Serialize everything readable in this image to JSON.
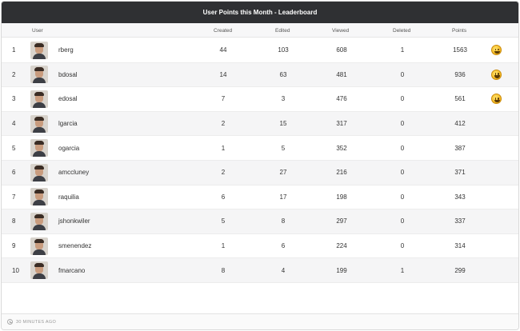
{
  "title": "User Points this Month - Leaderboard",
  "columns": {
    "user": "User",
    "created": "Created",
    "edited": "Edited",
    "viewed": "Viewed",
    "deleted": "Deleted",
    "points": "Points"
  },
  "rows": [
    {
      "rank": "1",
      "user": "rberg",
      "created": "44",
      "edited": "103",
      "viewed": "608",
      "deleted": "1",
      "points": "1563",
      "badge": true
    },
    {
      "rank": "2",
      "user": "bdosal",
      "created": "14",
      "edited": "63",
      "viewed": "481",
      "deleted": "0",
      "points": "936",
      "badge": true
    },
    {
      "rank": "3",
      "user": "edosal",
      "created": "7",
      "edited": "3",
      "viewed": "476",
      "deleted": "0",
      "points": "561",
      "badge": true
    },
    {
      "rank": "4",
      "user": "lgarcia",
      "created": "2",
      "edited": "15",
      "viewed": "317",
      "deleted": "0",
      "points": "412",
      "badge": false
    },
    {
      "rank": "5",
      "user": "ogarcia",
      "created": "1",
      "edited": "5",
      "viewed": "352",
      "deleted": "0",
      "points": "387",
      "badge": false
    },
    {
      "rank": "6",
      "user": "amccluney",
      "created": "2",
      "edited": "27",
      "viewed": "216",
      "deleted": "0",
      "points": "371",
      "badge": false
    },
    {
      "rank": "7",
      "user": "raquilia",
      "created": "6",
      "edited": "17",
      "viewed": "198",
      "deleted": "0",
      "points": "343",
      "badge": false
    },
    {
      "rank": "8",
      "user": "jshonkwiler",
      "created": "5",
      "edited": "8",
      "viewed": "297",
      "deleted": "0",
      "points": "337",
      "badge": false
    },
    {
      "rank": "9",
      "user": "smenendez",
      "created": "1",
      "edited": "6",
      "viewed": "224",
      "deleted": "0",
      "points": "314",
      "badge": false
    },
    {
      "rank": "10",
      "user": "fmarcano",
      "created": "8",
      "edited": "4",
      "viewed": "199",
      "deleted": "1",
      "points": "299",
      "badge": false
    }
  ],
  "footer": {
    "updated": "30 MINUTES AGO",
    "icon": "clock-icon"
  },
  "colors": {
    "title_bar": "#2f3033",
    "row_alt": "#f5f5f6",
    "badge": "#f3b51c"
  }
}
